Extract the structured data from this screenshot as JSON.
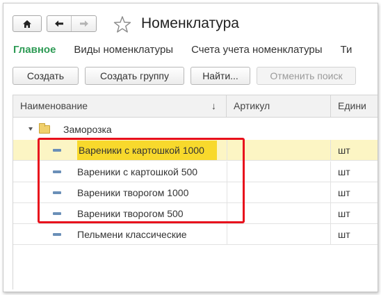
{
  "window": {
    "title": "Номенклатура",
    "nav": {
      "home_icon": "home-icon",
      "back_icon": "arrow-left-icon",
      "forward_icon": "arrow-right-icon",
      "favorite_icon": "star-icon"
    }
  },
  "section_tabs": [
    {
      "label": "Главное",
      "active": true
    },
    {
      "label": "Виды номенклатуры",
      "active": false
    },
    {
      "label": "Счета учета номенклатуры",
      "active": false
    },
    {
      "label": "Ти",
      "active": false
    }
  ],
  "toolbar": {
    "create": "Создать",
    "create_group": "Создать группу",
    "find": "Найти...",
    "cancel_search": "Отменить поиск"
  },
  "table": {
    "columns": {
      "name": "Наименование",
      "sort_indicator": "↓",
      "article": "Артикул",
      "unit": "Едини"
    },
    "group": {
      "label": "Заморозка",
      "expanded": true
    },
    "rows": [
      {
        "name": "Вареники с картошкой 1000",
        "unit": "шт",
        "selected": true
      },
      {
        "name": "Вареники с картошкой 500",
        "unit": "шт",
        "selected": false
      },
      {
        "name": "Вареники творогом 1000",
        "unit": "шт",
        "selected": false
      },
      {
        "name": "Вареники творогом 500",
        "unit": "шт",
        "selected": false
      },
      {
        "name": "Пельмени классические",
        "unit": "шт",
        "selected": false
      }
    ]
  },
  "colors": {
    "active_tab": "#2e9b55",
    "selected_row": "#fcf5c4",
    "selected_cell": "#f8d92c",
    "annotation_border": "#e8101c"
  }
}
